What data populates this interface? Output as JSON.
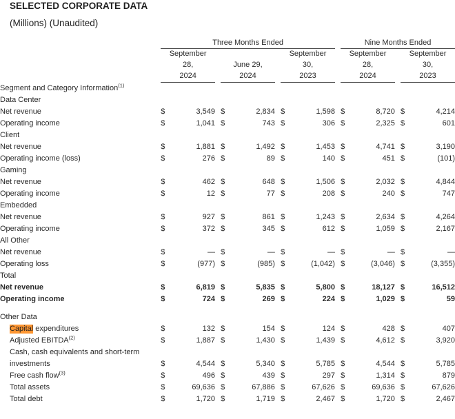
{
  "document": {
    "title": "SELECTED CORPORATE DATA",
    "subtitle": "(Millions) (Unaudited)"
  },
  "highlight": {
    "term": "Capital",
    "color": "#ff9632"
  },
  "table": {
    "column_groups": [
      {
        "label": "Three Months Ended",
        "span": 3
      },
      {
        "label": "Nine Months Ended",
        "span": 2
      }
    ],
    "columns": [
      {
        "month": "September",
        "day": "28,",
        "year": "2024"
      },
      {
        "month": "June 29,",
        "day": "2024",
        "year": ""
      },
      {
        "month": "September",
        "day": "30,",
        "year": "2023"
      },
      {
        "month": "September",
        "day": "28,",
        "year": "2024"
      },
      {
        "month": "September",
        "day": "30,",
        "year": "2023"
      }
    ],
    "currency_symbol": "$",
    "sections": [
      {
        "heading": "Segment and Category Information",
        "heading_sup": "(1)",
        "groups": [
          {
            "name": "Data Center",
            "rows": [
              {
                "label": "Net revenue",
                "values": [
                  "3,549",
                  "2,834",
                  "1,598",
                  "8,720",
                  "4,214"
                ]
              },
              {
                "label": "Operating income",
                "values": [
                  "1,041",
                  "743",
                  "306",
                  "2,325",
                  "601"
                ]
              }
            ]
          },
          {
            "name": "Client",
            "rows": [
              {
                "label": "Net revenue",
                "values": [
                  "1,881",
                  "1,492",
                  "1,453",
                  "4,741",
                  "3,190"
                ]
              },
              {
                "label": "Operating income (loss)",
                "values": [
                  "276",
                  "89",
                  "140",
                  "451",
                  "(101)"
                ]
              }
            ]
          },
          {
            "name": "Gaming",
            "rows": [
              {
                "label": "Net revenue",
                "values": [
                  "462",
                  "648",
                  "1,506",
                  "2,032",
                  "4,844"
                ]
              },
              {
                "label": "Operating income",
                "values": [
                  "12",
                  "77",
                  "208",
                  "240",
                  "747"
                ]
              }
            ]
          },
          {
            "name": "Embedded",
            "rows": [
              {
                "label": "Net revenue",
                "values": [
                  "927",
                  "861",
                  "1,243",
                  "2,634",
                  "4,264"
                ]
              },
              {
                "label": "Operating income",
                "values": [
                  "372",
                  "345",
                  "612",
                  "1,059",
                  "2,167"
                ]
              }
            ]
          },
          {
            "name": "All Other",
            "rows": [
              {
                "label": "Net revenue",
                "values": [
                  "—",
                  "—",
                  "—",
                  "—",
                  "—"
                ]
              },
              {
                "label": "Operating loss",
                "values": [
                  "(977)",
                  "(985)",
                  "(1,042)",
                  "(3,046)",
                  "(3,355)"
                ]
              }
            ]
          },
          {
            "name": "Total",
            "bold": true,
            "rows": [
              {
                "label": "Net revenue",
                "values": [
                  "6,819",
                  "5,835",
                  "5,800",
                  "18,127",
                  "16,512"
                ]
              },
              {
                "label": "Operating income",
                "values": [
                  "724",
                  "269",
                  "224",
                  "1,029",
                  "59"
                ]
              }
            ]
          }
        ]
      },
      {
        "heading": "Other Data",
        "heading_sup": "",
        "flat_rows": [
          {
            "label_pre": "",
            "label_hl": "Capital",
            "label_post": " expenditures",
            "sup": "",
            "values": [
              "132",
              "154",
              "124",
              "428",
              "407"
            ]
          },
          {
            "label_pre": "Adjusted EBITDA",
            "label_hl": "",
            "label_post": "",
            "sup": "(2)",
            "values": [
              "1,887",
              "1,430",
              "1,439",
              "4,612",
              "3,920"
            ]
          },
          {
            "label_pre": "Cash, cash equivalents and short-term",
            "label_hl": "",
            "label_post": "",
            "sup": "",
            "values": []
          },
          {
            "label_pre": "investments",
            "label_hl": "",
            "label_post": "",
            "sup": "",
            "values": [
              "4,544",
              "5,340",
              "5,785",
              "4,544",
              "5,785"
            ]
          },
          {
            "label_pre": "Free cash flow",
            "label_hl": "",
            "label_post": "",
            "sup": "(3)",
            "values": [
              "496",
              "439",
              "297",
              "1,314",
              "879"
            ]
          },
          {
            "label_pre": "Total assets",
            "label_hl": "",
            "label_post": "",
            "sup": "",
            "values": [
              "69,636",
              "67,886",
              "67,626",
              "69,636",
              "67,626"
            ]
          },
          {
            "label_pre": "Total debt",
            "label_hl": "",
            "label_post": "",
            "sup": "",
            "values": [
              "1,720",
              "1,719",
              "2,467",
              "1,720",
              "2,467"
            ]
          }
        ]
      }
    ]
  }
}
